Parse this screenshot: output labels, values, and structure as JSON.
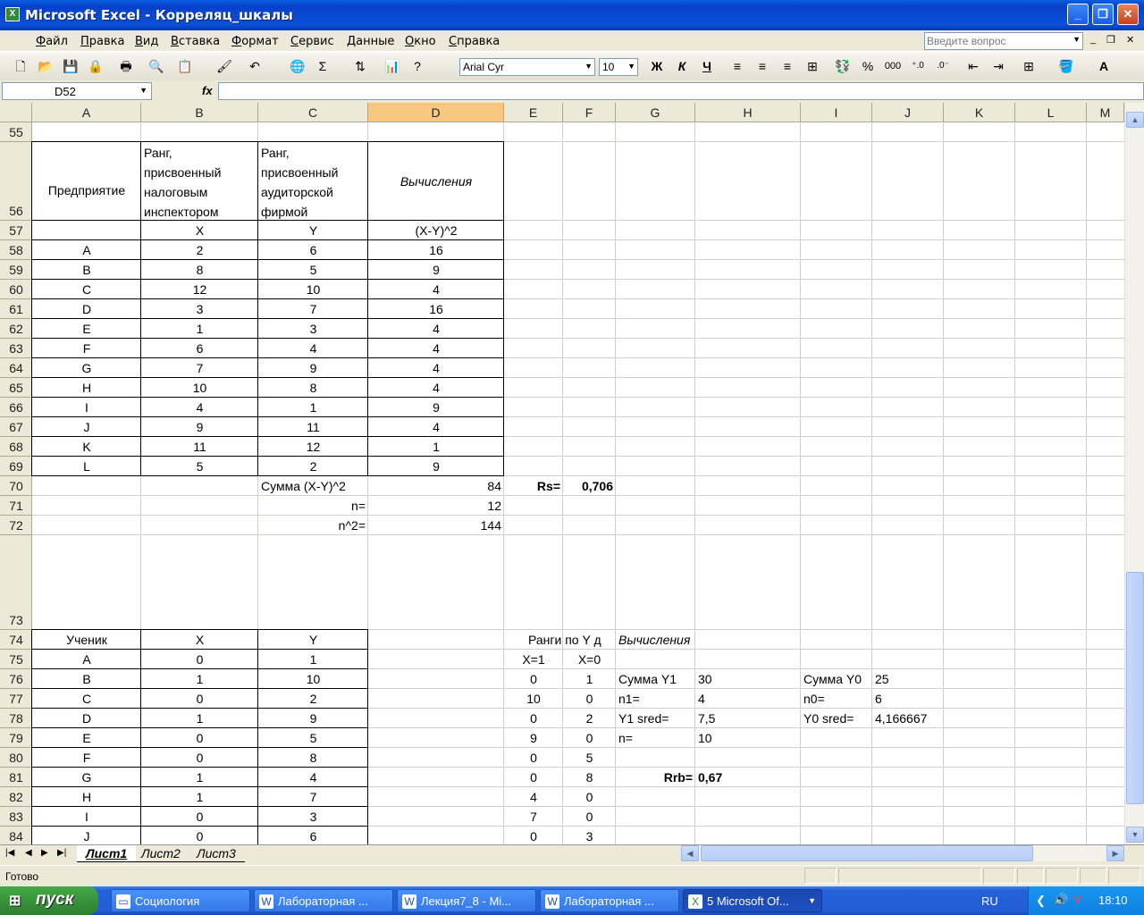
{
  "window": {
    "title": "Microsoft Excel - Корреляц_шкалы",
    "app_icon": "excel-icon"
  },
  "menu": [
    "Файл",
    "Правка",
    "Вид",
    "Вставка",
    "Формат",
    "Сервис",
    "Данные",
    "Окно",
    "Справка"
  ],
  "help_box": {
    "placeholder": "Введите вопрос"
  },
  "toolbar": {
    "font_name": "Arial Cyr",
    "font_size": "10",
    "bold": "Ж",
    "italic": "К",
    "underline": "Ч",
    "percent": "%",
    "thousands": "000",
    "sum": "Σ"
  },
  "formula_bar": {
    "name_box": "D52",
    "fx": "fx",
    "value": ""
  },
  "columns": [
    "A",
    "B",
    "C",
    "D",
    "E",
    "F",
    "G",
    "H",
    "I",
    "J",
    "K",
    "L",
    "M"
  ],
  "selected_column": "D",
  "rows": [
    "55",
    "56",
    "57",
    "58",
    "59",
    "60",
    "61",
    "62",
    "63",
    "64",
    "65",
    "66",
    "67",
    "68",
    "69",
    "70",
    "71",
    "72",
    "73",
    "74",
    "75",
    "76",
    "77",
    "78",
    "79",
    "80",
    "81",
    "82",
    "83",
    "84"
  ],
  "table1": {
    "header": {
      "a": "Предприятие",
      "b": [
        "Ранг,",
        "присвоенный",
        "налоговым",
        "инспектором"
      ],
      "c": [
        "Ранг,",
        "присвоенный",
        "аудиторской",
        "фирмой"
      ],
      "d": "Вычисления"
    },
    "subheader": {
      "b": "X",
      "c": "Y",
      "d": "(X-Y)^2"
    },
    "rows": [
      [
        "A",
        "2",
        "6",
        "16"
      ],
      [
        "B",
        "8",
        "5",
        "9"
      ],
      [
        "C",
        "12",
        "10",
        "4"
      ],
      [
        "D",
        "3",
        "7",
        "16"
      ],
      [
        "E",
        "1",
        "3",
        "4"
      ],
      [
        "F",
        "6",
        "4",
        "4"
      ],
      [
        "G",
        "7",
        "9",
        "4"
      ],
      [
        "H",
        "10",
        "8",
        "4"
      ],
      [
        "I",
        "4",
        "1",
        "9"
      ],
      [
        "J",
        "9",
        "11",
        "4"
      ],
      [
        "K",
        "11",
        "12",
        "1"
      ],
      [
        "L",
        "5",
        "2",
        "9"
      ]
    ],
    "sum_label": "Сумма (X-Y)^2",
    "sum_value": "84",
    "n_label": "n=",
    "n_value": "12",
    "n2_label": "n^2=",
    "n2_value": "144",
    "rs_label": "Rs=",
    "rs_value": "0,706"
  },
  "table2": {
    "header": {
      "a": "Ученик",
      "b": "X",
      "c": "Y"
    },
    "rows": [
      [
        "A",
        "0",
        "1"
      ],
      [
        "B",
        "1",
        "10"
      ],
      [
        "C",
        "0",
        "2"
      ],
      [
        "D",
        "1",
        "9"
      ],
      [
        "E",
        "0",
        "5"
      ],
      [
        "F",
        "0",
        "8"
      ],
      [
        "G",
        "1",
        "4"
      ],
      [
        "H",
        "1",
        "7"
      ],
      [
        "I",
        "0",
        "3"
      ],
      [
        "J",
        "0",
        "6"
      ]
    ],
    "ranks_title": "Ранги по Y д",
    "calc_title": "Вычисления",
    "x1_label": "X=1",
    "x0_label": "X=0",
    "ranks": [
      [
        "0",
        "1"
      ],
      [
        "10",
        "0"
      ],
      [
        "0",
        "2"
      ],
      [
        "9",
        "0"
      ],
      [
        "0",
        "5"
      ],
      [
        "0",
        "8"
      ],
      [
        "4",
        "0"
      ],
      [
        "7",
        "0"
      ],
      [
        "0",
        "3"
      ]
    ],
    "stats": {
      "sum_y1_label": "Сумма Y1",
      "sum_y1": "30",
      "n1_label": "n1=",
      "n1": "4",
      "y1_sred_label": "Y1 sred=",
      "y1_sred": "7,5",
      "n_label": "n=",
      "n": "10",
      "sum_y0_label": "Сумма Y0",
      "sum_y0": "25",
      "n0_label": "n0=",
      "n0": "6",
      "y0_sred_label": "Y0 sred=",
      "y0_sred": "4,166667",
      "rrb_label": "Rrb=",
      "rrb": "0,67"
    }
  },
  "sheet_tabs": [
    "Лист1",
    "Лист2",
    "Лист3"
  ],
  "active_tab": "Лист1",
  "status": "Готово",
  "taskbar": {
    "start": "пуск",
    "items": [
      "Социология",
      "Лабораторная ...",
      "Лекция7_8 - Mi...",
      "Лабораторная ...",
      "5 Microsoft Of..."
    ],
    "lang": "RU",
    "clock": "18:10"
  }
}
